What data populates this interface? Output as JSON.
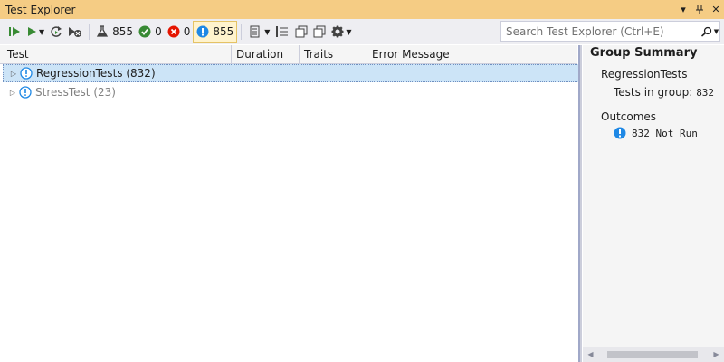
{
  "window": {
    "title": "Test Explorer",
    "pin_glyph": "📌",
    "close_glyph": "✕"
  },
  "toolbar": {
    "total_count": "855",
    "passed_count": "0",
    "failed_count": "0",
    "notrun_count": "855",
    "search_placeholder": "Search Test Explorer (Ctrl+E)"
  },
  "columns": {
    "test": "Test",
    "duration": "Duration",
    "traits": "Traits",
    "error": "Error Message"
  },
  "tree": {
    "items": [
      {
        "label": "RegressionTests",
        "count": "(832)"
      },
      {
        "label": "StressTest",
        "count": "(23)"
      }
    ]
  },
  "summary": {
    "title": "Group Summary",
    "group_name": "RegressionTests",
    "tests_in_group_label": "Tests in group:",
    "tests_in_group_value": "832",
    "outcomes_label": "Outcomes",
    "not_run_text": "832 Not Run"
  },
  "colors": {
    "title_bar": "#f5cc84",
    "toolbar_bg": "#eeeef2",
    "info_blue": "#1e88e5",
    "pass_green": "#388a34",
    "fail_red": "#e51400",
    "run_green": "#388a34"
  }
}
